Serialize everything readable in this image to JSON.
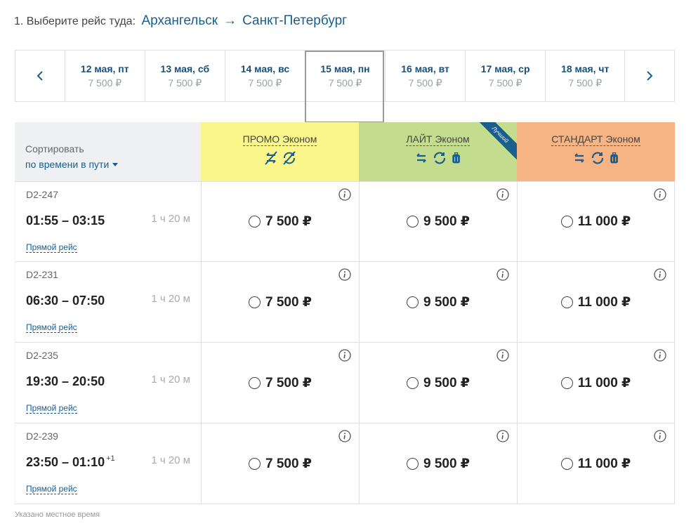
{
  "header": {
    "step_label": "1. Выберите рейс туда:",
    "origin": "Архангельск",
    "arrow": "→",
    "destination": "Санкт-Петербург"
  },
  "dates": [
    {
      "date": "12 мая, пт",
      "price": "7 500 ₽"
    },
    {
      "date": "13 мая, сб",
      "price": "7 500 ₽"
    },
    {
      "date": "14 мая, вс",
      "price": "7 500 ₽"
    },
    {
      "date": "15 мая, пн",
      "price": "7 500 ₽",
      "selected": true
    },
    {
      "date": "16 мая, вт",
      "price": "7 500 ₽"
    },
    {
      "date": "17 мая, ср",
      "price": "7 500 ₽"
    },
    {
      "date": "18 мая, чт",
      "price": "7 500 ₽"
    }
  ],
  "sort": {
    "label": "Сортировать",
    "value": "по времени в пути"
  },
  "tariffs": [
    {
      "name": "ПРОМО Эконом",
      "color": "#fbf68c",
      "icons": [
        "no-exchange-icon",
        "no-refund-icon"
      ]
    },
    {
      "name": "ЛАЙТ Эконом",
      "color": "#c3dc8e",
      "badge": "Лучший",
      "icons": [
        "exchange-icon",
        "refund-icon",
        "baggage-icon"
      ]
    },
    {
      "name": "СТАНДАРТ Эконом",
      "color": "#f6b383",
      "icons": [
        "exchange-icon",
        "refund-icon",
        "baggage-icon"
      ]
    }
  ],
  "flights": [
    {
      "number": "D2-247",
      "times": "01:55 – 03:15",
      "next_day": "",
      "duration": "1 ч 20 м",
      "type": "Прямой рейс",
      "prices": [
        "7 500 ₽",
        "9 500 ₽",
        "11 000 ₽"
      ]
    },
    {
      "number": "D2-231",
      "times": "06:30 – 07:50",
      "next_day": "",
      "duration": "1 ч 20 м",
      "type": "Прямой рейс",
      "prices": [
        "7 500 ₽",
        "9 500 ₽",
        "11 000 ₽"
      ]
    },
    {
      "number": "D2-235",
      "times": "19:30 – 20:50",
      "next_day": "",
      "duration": "1 ч 20 м",
      "type": "Прямой рейс",
      "prices": [
        "7 500 ₽",
        "9 500 ₽",
        "11 000 ₽"
      ]
    },
    {
      "number": "D2-239",
      "times": "23:50 – 01:10",
      "next_day": "+1",
      "duration": "1 ч 20 м",
      "type": "Прямой рейс",
      "prices": [
        "7 500 ₽",
        "9 500 ₽",
        "11 000 ₽"
      ]
    }
  ],
  "footnote": "Указано местное время",
  "colors": {
    "accent": "#1a5e8e",
    "date_text": "#1a4f7a"
  }
}
